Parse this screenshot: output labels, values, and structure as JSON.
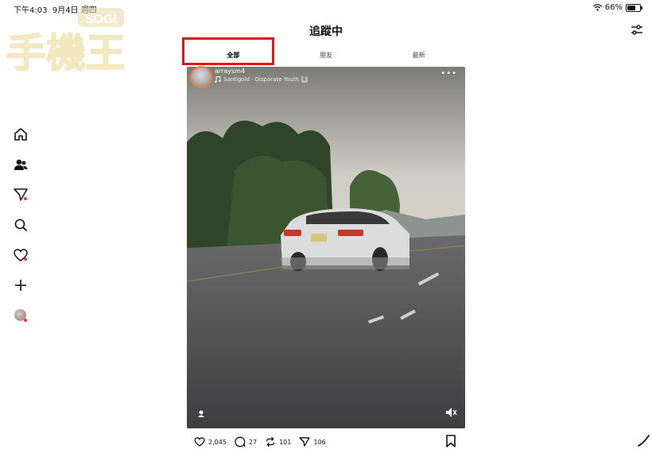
{
  "status": {
    "time": "下午4:03",
    "date": "9月4日 週四",
    "battery": "66%",
    "battery_level": 0.66
  },
  "watermark": {
    "text_top": "SOGI",
    "text_main": "手機王"
  },
  "header": {
    "title": "追蹤中"
  },
  "tabs": [
    {
      "label": "全部",
      "active": true
    },
    {
      "label": "朋友"
    },
    {
      "label": "最新"
    }
  ],
  "post": {
    "username": "arraysm4",
    "music": "Santigold · Disparate Youth",
    "explicit": "E",
    "more": "•••",
    "likes": "2,045",
    "comments": "27",
    "reposts": "101",
    "shares": "106"
  },
  "icons": {
    "home": "home-icon",
    "people": "people-icon",
    "messages": "send-icon",
    "search": "search-icon",
    "activity": "heart-icon",
    "create": "plus-icon",
    "profile": "avatar",
    "filter": "filter-icon"
  },
  "colors": {
    "highlight": "#e01616",
    "badge": "#ff2d55",
    "avatar_ring": "#ff7a3d"
  }
}
